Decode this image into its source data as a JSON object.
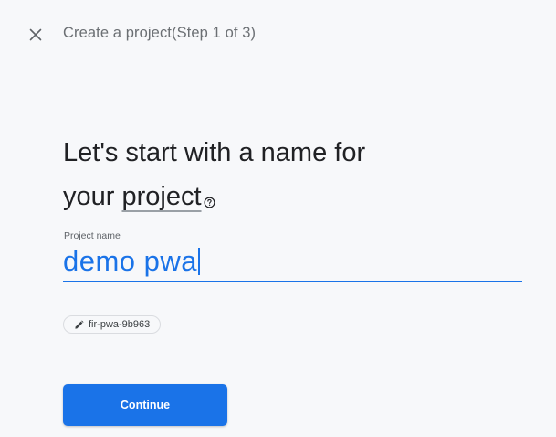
{
  "header": {
    "close_icon": "close-icon",
    "step_title": "Create a project(Step 1 of 3)"
  },
  "main": {
    "heading_line1": "Let's start with a name for",
    "heading_line2_prefix": "your ",
    "heading_term": "project",
    "help_icon": "question-circle-icon"
  },
  "project_name_field": {
    "label": "Project name",
    "value": "demo pwa"
  },
  "project_id_chip": {
    "icon": "pencil-icon",
    "value": "fir-pwa-9b963"
  },
  "actions": {
    "continue_label": "Continue"
  },
  "colors": {
    "accent": "#1a73e8",
    "background": "#f7f8fa",
    "text_primary": "#202124",
    "text_secondary": "#6b6f73"
  }
}
